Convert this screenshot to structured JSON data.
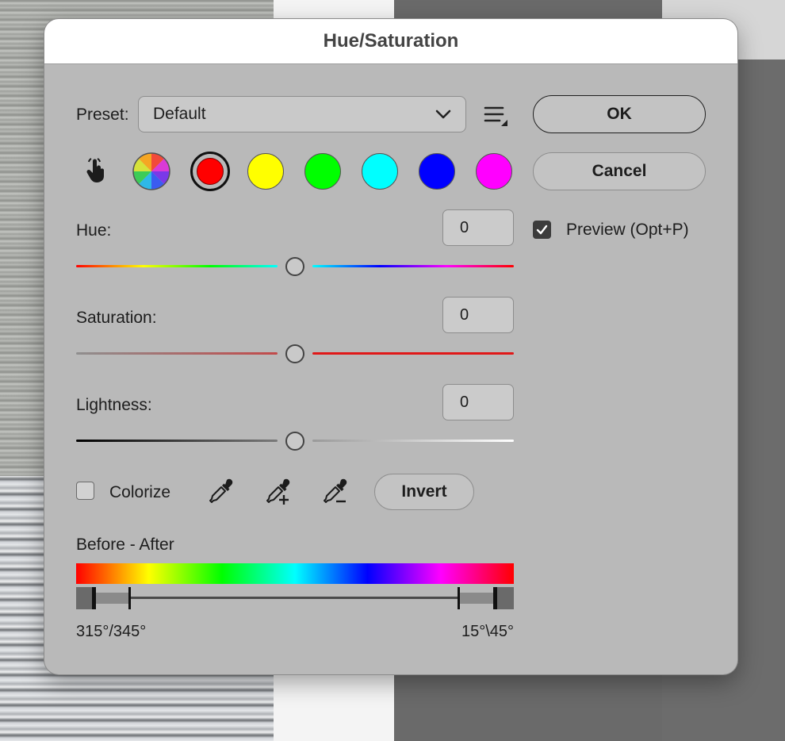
{
  "dialog": {
    "title": "Hue/Saturation",
    "preset_label": "Preset:",
    "preset_value": "Default",
    "ok_label": "OK",
    "cancel_label": "Cancel",
    "preview_label": "Preview (Opt+P)",
    "preview_checked": true,
    "colorize_label": "Colorize",
    "colorize_checked": false,
    "invert_label": "Invert",
    "before_after_label": "Before - After",
    "range_left": "315°/345°",
    "range_right": "15°\\45°"
  },
  "channels": [
    {
      "name": "master",
      "icon": "color-wheel-icon"
    },
    {
      "name": "reds",
      "color": "#ff0000",
      "selected": true
    },
    {
      "name": "yellows",
      "color": "#ffff00"
    },
    {
      "name": "greens",
      "color": "#00ff00"
    },
    {
      "name": "cyans",
      "color": "#00ffff"
    },
    {
      "name": "blues",
      "color": "#0000ff"
    },
    {
      "name": "magentas",
      "color": "#ff00ff"
    }
  ],
  "sliders": {
    "hue": {
      "label": "Hue:",
      "value": "0"
    },
    "saturation": {
      "label": "Saturation:",
      "value": "0"
    },
    "lightness": {
      "label": "Lightness:",
      "value": "0"
    }
  },
  "icons": {
    "targeted_adjust": "hand-pointer-icon",
    "preset_menu": "menu-lines-icon",
    "eyedropper": "eyedropper-icon",
    "eyedropper_add": "eyedropper-plus-icon",
    "eyedropper_subtract": "eyedropper-minus-icon"
  }
}
